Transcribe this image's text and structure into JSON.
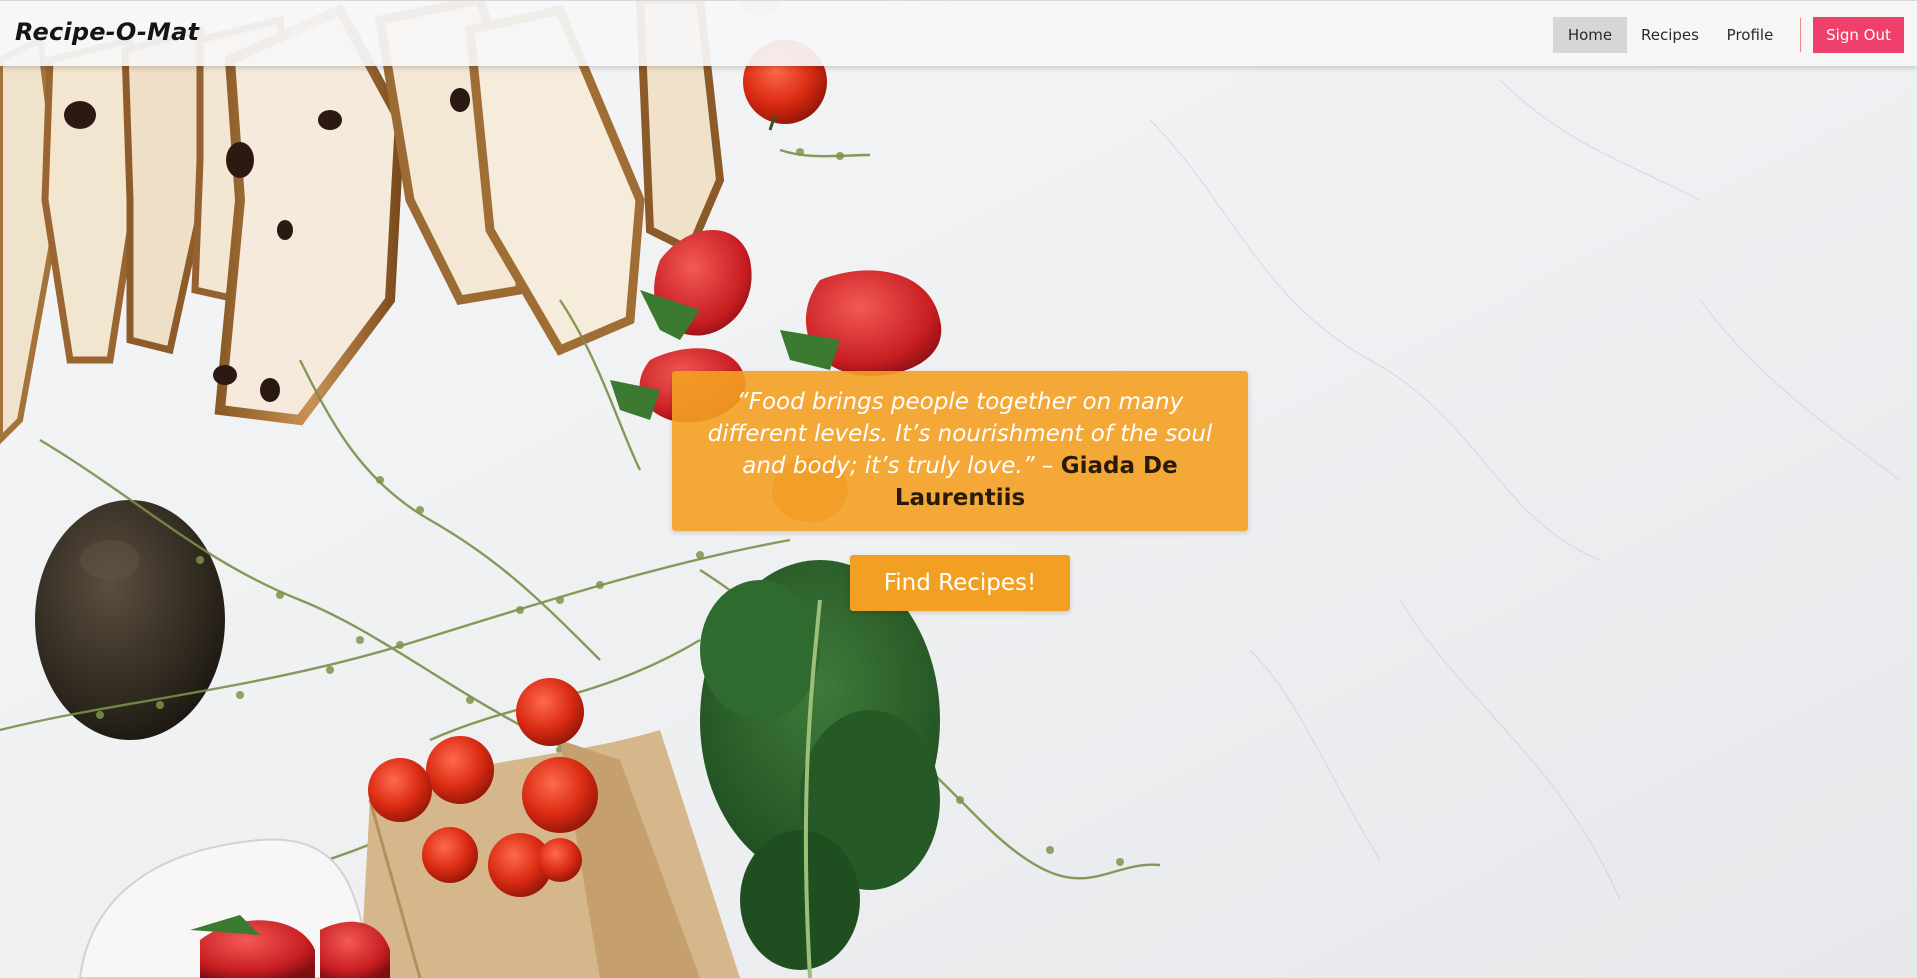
{
  "navbar": {
    "brand": "Recipe-O-Mat",
    "links": {
      "home": "Home",
      "recipes": "Recipes",
      "profile": "Profile"
    },
    "active": "Home",
    "sign_out": "Sign Out"
  },
  "hero": {
    "quote": "“Food brings people together on many different levels. It’s nourishment of the soul and body; it’s truly love.”",
    "dash": " – ",
    "author": "Giada De Laurentiis",
    "cta": "Find Recipes!"
  },
  "colors": {
    "accent_orange": "#f2a024",
    "sign_out_pink": "#ef3f6b",
    "active_nav_bg": "#d6d6d8"
  },
  "background": {
    "description_icon": "food-flatlay-image"
  }
}
